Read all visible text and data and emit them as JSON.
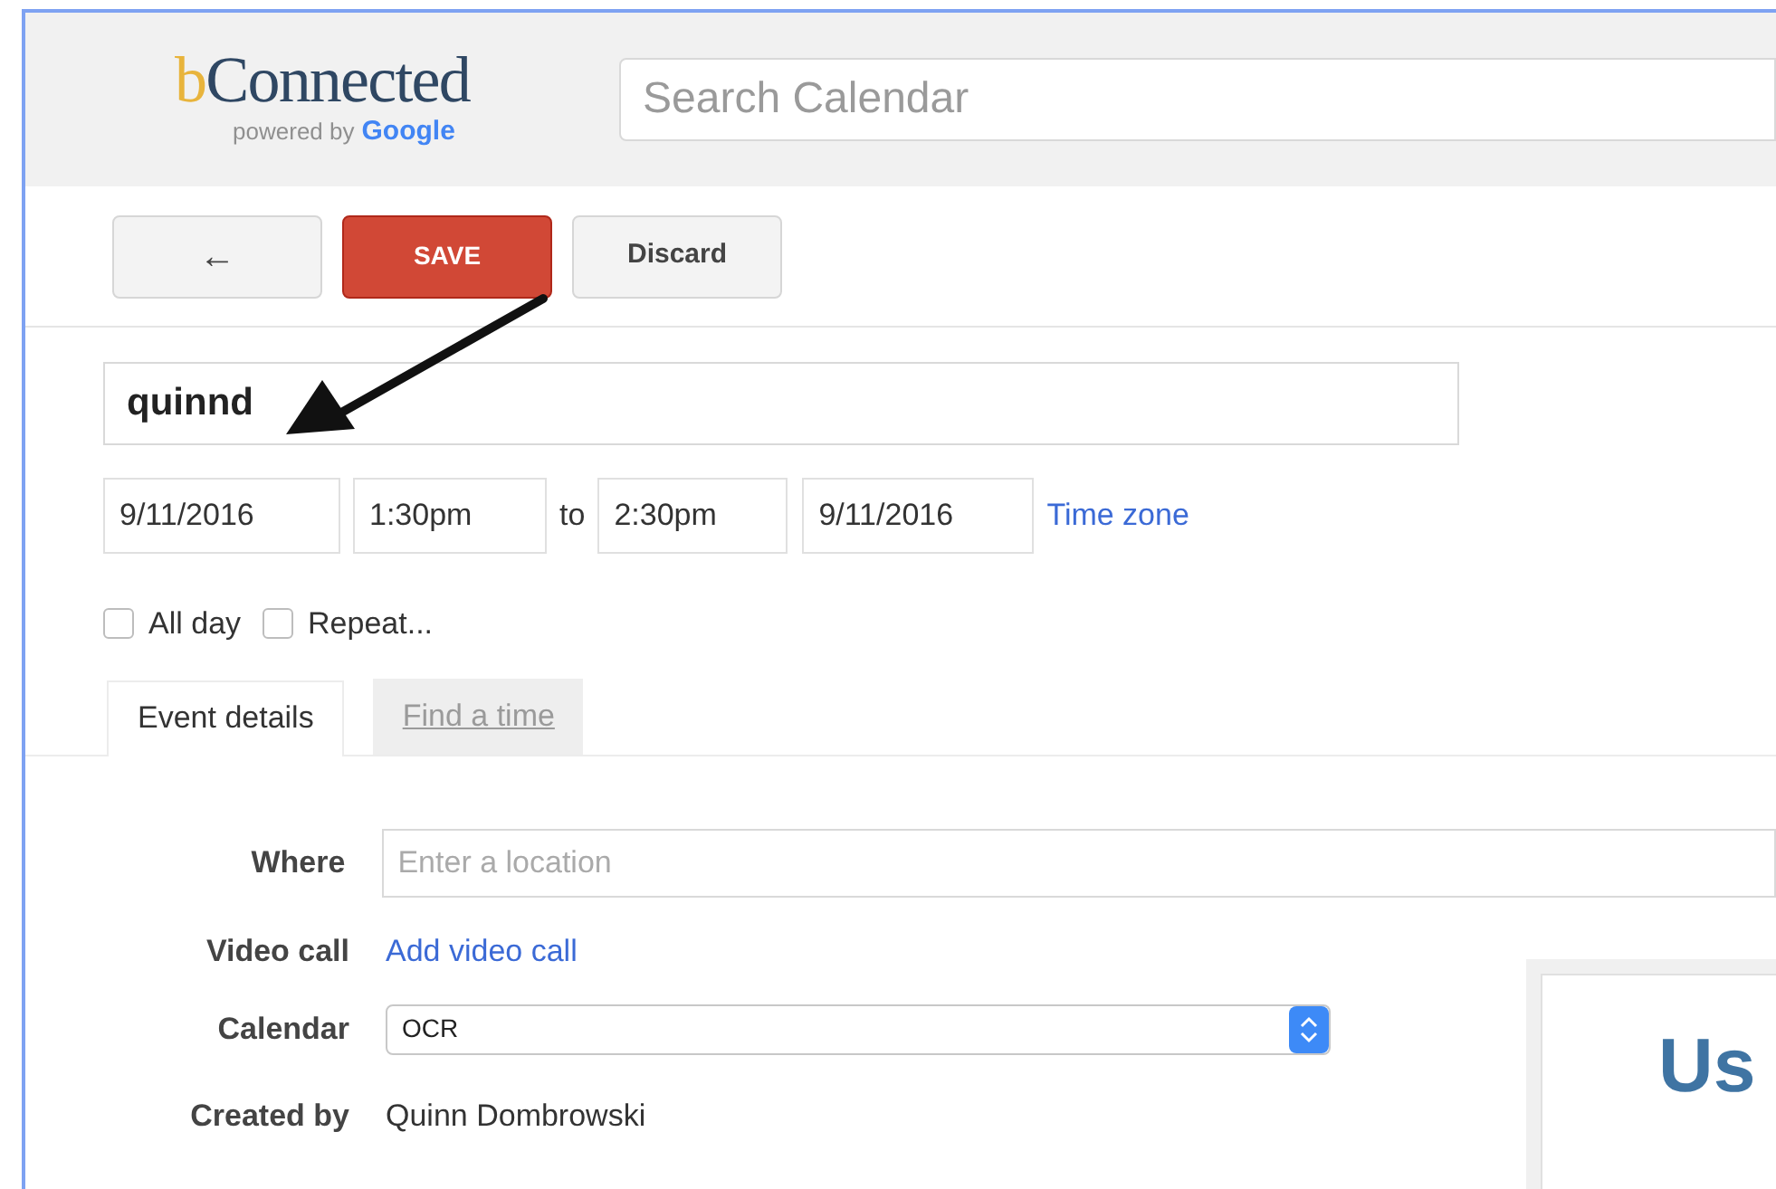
{
  "logo": {
    "name": "bConnected",
    "powered_by": "powered by",
    "brand": "Google"
  },
  "search": {
    "placeholder": "Search Calendar"
  },
  "toolbar": {
    "back": "←",
    "save": "SAVE",
    "discard": "Discard"
  },
  "event": {
    "title": "quinnd",
    "start_date": "9/11/2016",
    "start_time": "1:30pm",
    "to": "to",
    "end_time": "2:30pm",
    "end_date": "9/11/2016",
    "time_zone": "Time zone"
  },
  "options": [
    {
      "label": "All day",
      "checked": false
    },
    {
      "label": "Repeat...",
      "checked": false
    }
  ],
  "tabs": [
    {
      "label": "Event details",
      "selected": true
    },
    {
      "label": "Find a time",
      "selected": false
    }
  ],
  "details": [
    {
      "kind": "input",
      "label": "Where",
      "placeholder": "Enter a location"
    },
    {
      "kind": "link",
      "label": "Video call",
      "value": "Add video call"
    },
    {
      "kind": "select",
      "label": "Calendar",
      "value": "OCR"
    },
    {
      "kind": "text",
      "label": "Created by",
      "value": "Quinn Dombrowski"
    }
  ],
  "side_card": {
    "heading": "Us"
  }
}
